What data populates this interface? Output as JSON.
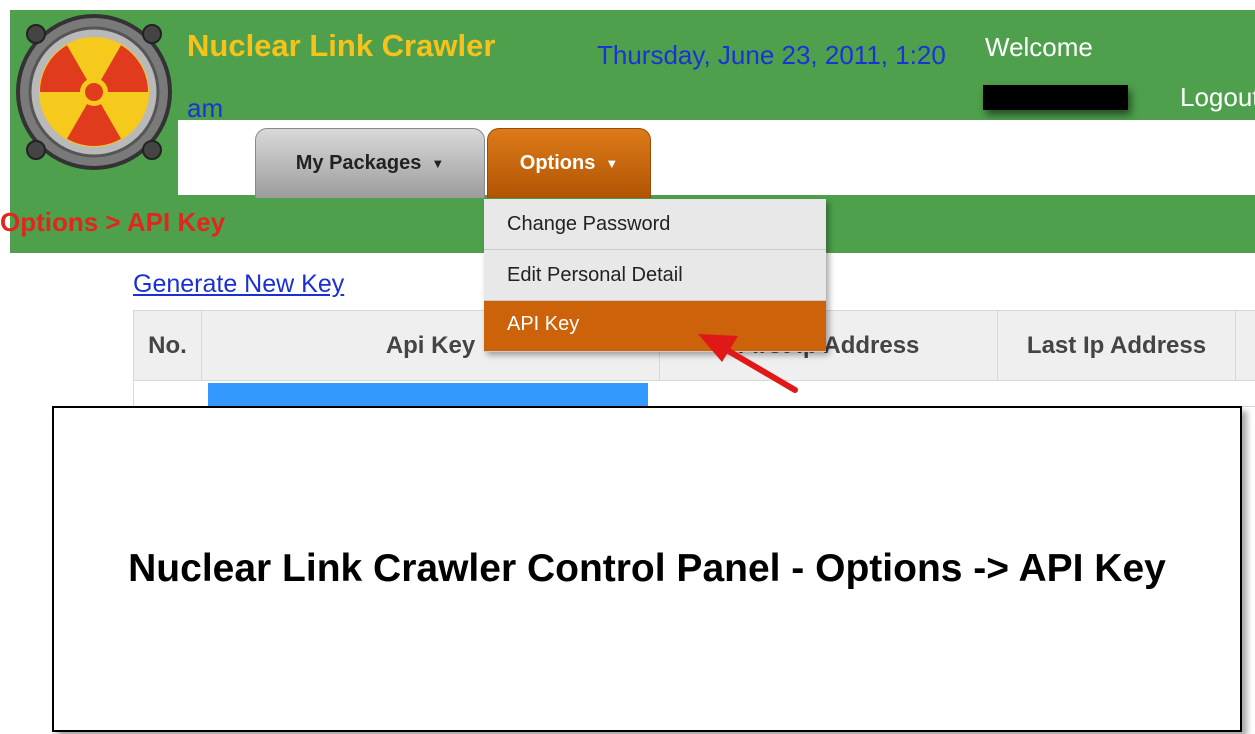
{
  "header": {
    "app_title": "Nuclear Link Crawler",
    "datetime": "Thursday, June 23, 2011, 1:20 am",
    "welcome": "Welcome",
    "logout": "Logout"
  },
  "nav": {
    "tabs": [
      {
        "label": "My Packages",
        "icon": "caret-down-icon"
      },
      {
        "label": "Options",
        "icon": "caret-down-icon"
      }
    ],
    "active_tab": "Options"
  },
  "breadcrumb": "Options > API Key",
  "options_menu": {
    "items": [
      {
        "label": "Change Password"
      },
      {
        "label": "Edit Personal Detail"
      },
      {
        "label": "API Key"
      }
    ],
    "active_item": "API Key"
  },
  "main": {
    "generate_link": "Generate New Key",
    "table": {
      "headers": [
        "No.",
        "Api Key",
        "First Ip Address",
        "Last Ip Address"
      ]
    }
  },
  "caption": "Nuclear Link Crawler Control Panel - Options -> API Key",
  "colors": {
    "header_green": "#4ea04c",
    "title_yellow": "#f7c21c",
    "date_blue": "#1a33d6",
    "options_orange": "#cc6209",
    "breadcrumb_red": "#e0271d"
  }
}
